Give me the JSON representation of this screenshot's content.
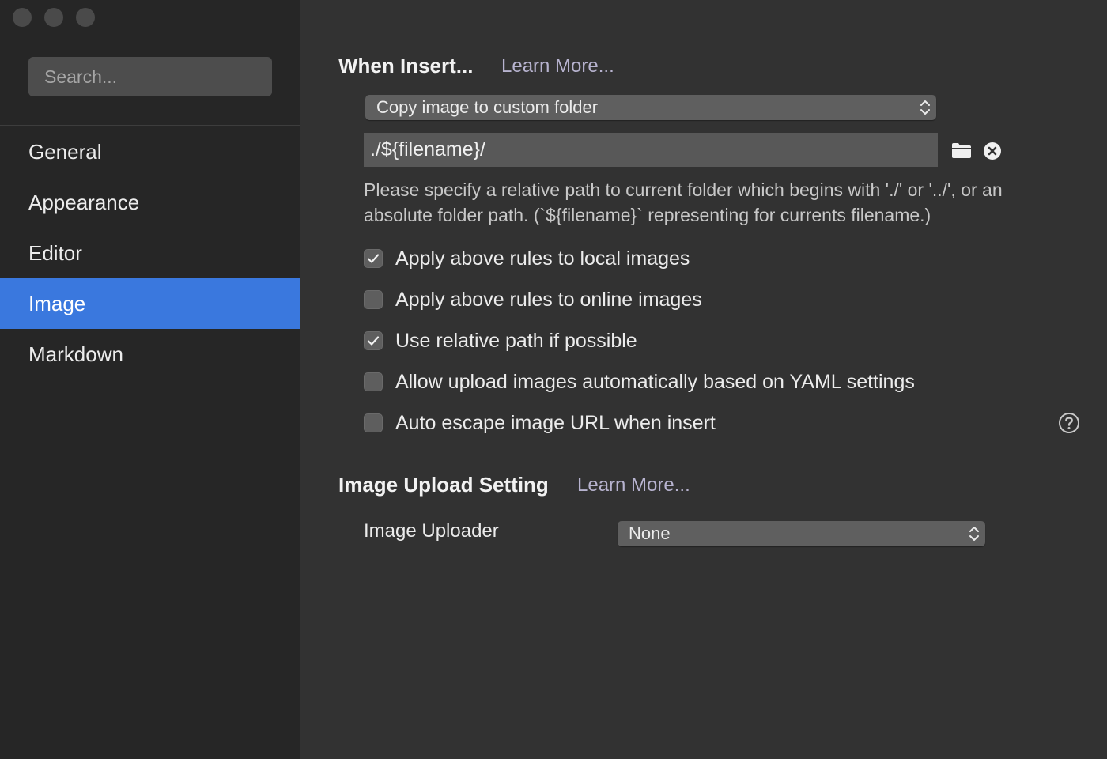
{
  "sidebar": {
    "search_placeholder": "Search...",
    "items": [
      {
        "label": "General"
      },
      {
        "label": "Appearance"
      },
      {
        "label": "Editor"
      },
      {
        "label": "Image",
        "active": true
      },
      {
        "label": "Markdown"
      }
    ]
  },
  "insert": {
    "title": "When Insert...",
    "learn_more": "Learn More...",
    "action_selected": "Copy image to custom folder",
    "path_value": "./${filename}/",
    "help_text": "Please specify a relative path to current folder which begins with './' or '../', or an absolute folder path. (`${filename}` representing for currents filename.)",
    "options": [
      {
        "label": "Apply above rules to local images",
        "checked": true
      },
      {
        "label": "Apply above rules to online images",
        "checked": false
      },
      {
        "label": "Use relative path if possible",
        "checked": true
      },
      {
        "label": "Allow upload images automatically based on YAML settings",
        "checked": false
      },
      {
        "label": "Auto escape image URL when insert",
        "checked": false
      }
    ]
  },
  "upload": {
    "title": "Image Upload Setting",
    "learn_more": "Learn More...",
    "uploader_label": "Image Uploader",
    "uploader_selected": "None"
  },
  "icons": {
    "folder": "folder-icon",
    "clear": "clear-icon",
    "help": "question-mark-icon",
    "updown": "chevron-up-down-icon",
    "check": "checkmark-icon"
  },
  "colors": {
    "accent": "#3a78de",
    "sidebar_bg": "#262626",
    "content_bg": "#323232",
    "link": "#b7b3cf"
  }
}
